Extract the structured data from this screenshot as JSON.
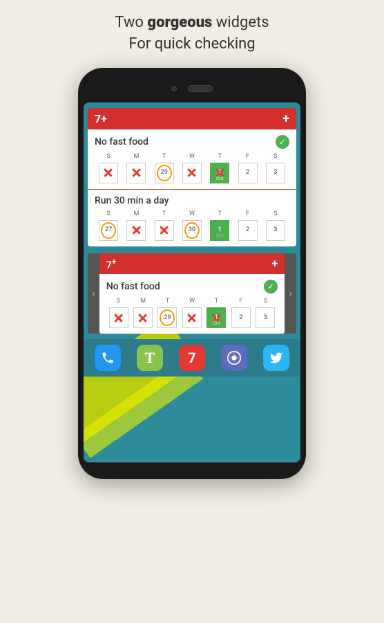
{
  "headline": {
    "line1": "Two ",
    "bold": "gorgeous",
    "line1_end": " widgets",
    "line2": "For quick checking"
  },
  "widget1": {
    "title_num": "7+",
    "plus_label": "+",
    "habits": [
      {
        "name": "No fast food",
        "has_check": true,
        "days": [
          "S",
          "M",
          "T",
          "W",
          "T",
          "F",
          "S"
        ],
        "cells": [
          {
            "type": "x"
          },
          {
            "type": "x"
          },
          {
            "type": "circle",
            "num": "29"
          },
          {
            "type": "x"
          },
          {
            "type": "today_x",
            "num": "1",
            "sub": "Oct"
          },
          {
            "type": "num",
            "num": "2"
          },
          {
            "type": "num",
            "num": "3"
          }
        ]
      },
      {
        "name": "Run 30 min a day",
        "has_check": false,
        "days": [
          "S",
          "M",
          "T",
          "W",
          "T",
          "F",
          "S"
        ],
        "cells": [
          {
            "type": "circle",
            "num": "27"
          },
          {
            "type": "x"
          },
          {
            "type": "x"
          },
          {
            "type": "circle",
            "num": "30"
          },
          {
            "type": "today",
            "num": "1",
            "sub": "Oct"
          },
          {
            "type": "num",
            "num": "2"
          },
          {
            "type": "num",
            "num": "3"
          }
        ]
      }
    ]
  },
  "widget2": {
    "title_num": "7+",
    "plus_label": "+",
    "habits": [
      {
        "name": "No fast food",
        "has_check": true,
        "days": [
          "S",
          "M",
          "T",
          "W",
          "T",
          "F",
          "S"
        ],
        "cells": [
          {
            "type": "x"
          },
          {
            "type": "x"
          },
          {
            "type": "circle",
            "num": "29"
          },
          {
            "type": "x"
          },
          {
            "type": "today_x",
            "num": "1",
            "sub": "Oct"
          },
          {
            "type": "num",
            "num": "2"
          },
          {
            "type": "num",
            "num": "3"
          }
        ]
      }
    ]
  },
  "bottom_apps": [
    {
      "icon": "📞",
      "type": "phone-app",
      "label": "Phone"
    },
    {
      "icon": "T",
      "type": "type-app",
      "label": "Type"
    },
    {
      "icon": "7",
      "type": "num-app",
      "label": "Seven"
    },
    {
      "icon": "chrome",
      "type": "chrome-app",
      "label": "Chrome"
    },
    {
      "icon": "🐦",
      "type": "twitter-app",
      "label": "Twitter"
    }
  ],
  "nav_icons": [
    "◁",
    "○",
    "□"
  ]
}
